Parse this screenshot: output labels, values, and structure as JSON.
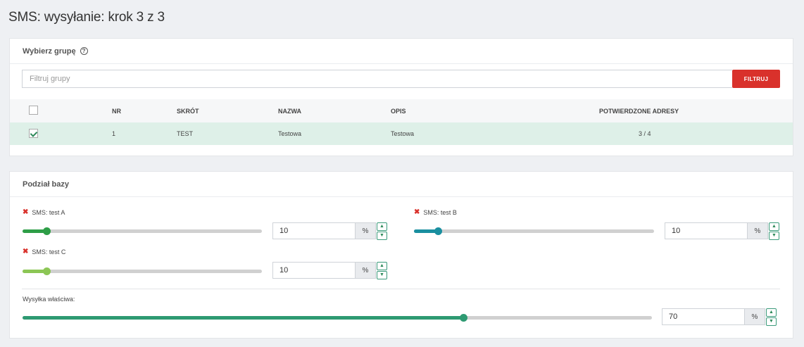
{
  "page": {
    "title": "SMS: wysyłanie: krok 3 z 3"
  },
  "group_panel": {
    "title": "Wybierz grupę",
    "help_glyph": "?",
    "filter_placeholder": "Filtruj grupy",
    "filter_button": "FILTRUJ",
    "columns": [
      "NR",
      "SKRÓT",
      "NAZWA",
      "OPIS",
      "POTWIERDZONE ADRESY"
    ],
    "rows": [
      {
        "checked": true,
        "nr": "1",
        "skrot": "TEST",
        "nazwa": "Testowa",
        "opis": "Testowa",
        "potwierdzone": "3 / 4"
      }
    ]
  },
  "split_panel": {
    "title": "Podział bazy",
    "remove_glyph": "✖",
    "unit": "%",
    "step_up": "▲",
    "step_down": "▼",
    "sliders": [
      {
        "label": "SMS: test A",
        "value": "10",
        "percent": 10,
        "color": "#2e9e47"
      },
      {
        "label": "SMS: test B",
        "value": "10",
        "percent": 10,
        "color": "#1a8fa0"
      },
      {
        "label": "SMS: test C",
        "value": "10",
        "percent": 10,
        "color": "#8cc655"
      }
    ],
    "main": {
      "label": "Wysyłka właściwa:",
      "value": "70",
      "percent": 70,
      "color": "#2e9a72"
    }
  }
}
